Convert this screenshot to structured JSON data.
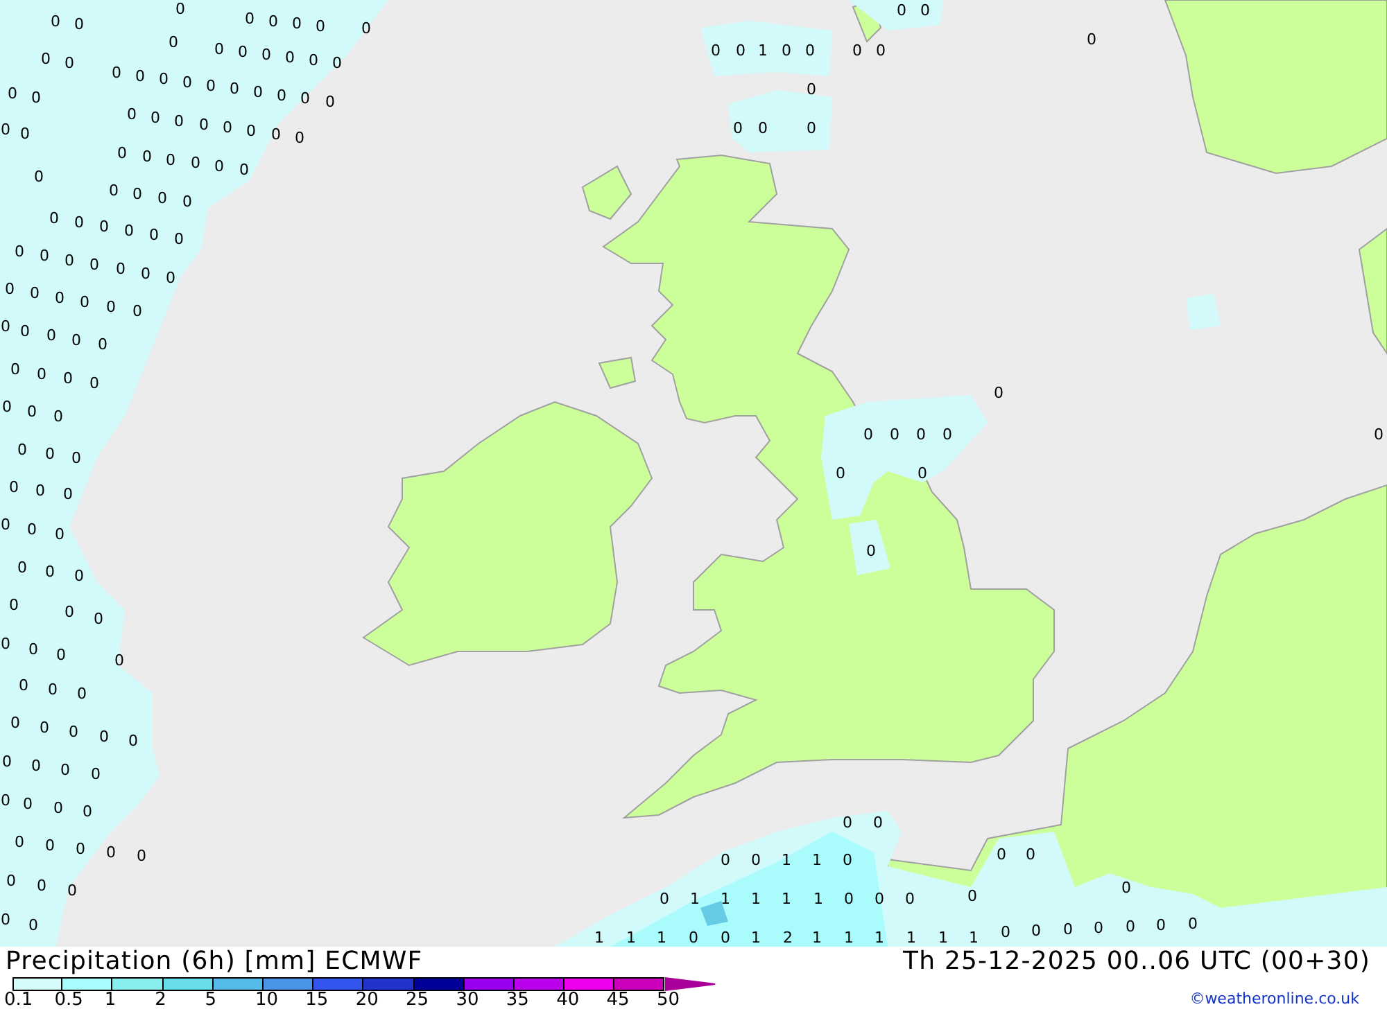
{
  "map": {
    "value_rows": [
      [
        "0"
      ],
      [
        "0",
        "0"
      ],
      [
        "0",
        "0"
      ],
      [
        "0",
        "0",
        "0",
        "0",
        "0"
      ],
      [
        "0"
      ],
      [
        "0"
      ],
      [
        "0",
        "0"
      ],
      [
        "0",
        "0",
        "0",
        "0",
        "0",
        "0"
      ],
      [
        "0",
        "0",
        "1",
        "0",
        "0"
      ],
      [
        "0",
        "0"
      ],
      [
        "0",
        "0"
      ],
      [
        "0",
        "0",
        "0",
        "0",
        "0",
        "0",
        "0",
        "0",
        "0",
        "0"
      ],
      [
        "0"
      ],
      [
        "0",
        "0"
      ],
      [
        "0",
        "0",
        "0",
        "0",
        "0",
        "0",
        "0",
        "0"
      ],
      [
        "0",
        "0",
        "0"
      ],
      [
        "0"
      ],
      [
        "0",
        "0",
        "0",
        "0",
        "0",
        "0"
      ],
      [
        "0",
        "0",
        "0",
        "0"
      ],
      [
        "0",
        "0",
        "0",
        "0",
        "0",
        "0"
      ],
      [
        "0",
        "0",
        "0",
        "0",
        "0",
        "0",
        "0"
      ],
      [
        "0",
        "0",
        "0",
        "0",
        "0",
        "0"
      ],
      [
        "0",
        "0",
        "0",
        "0",
        "0"
      ],
      [
        "0",
        "0",
        "0",
        "0"
      ],
      [
        "0"
      ],
      [
        "0",
        "0",
        "0"
      ],
      [
        "0",
        "0",
        "0",
        "0"
      ],
      [
        "0"
      ],
      [
        "0",
        "0",
        "0"
      ],
      [
        "0",
        "0"
      ],
      [
        "0",
        "0",
        "0"
      ],
      [
        "0",
        "0",
        "0"
      ],
      [
        "0"
      ],
      [
        "0",
        "0",
        "0"
      ],
      [
        "0",
        "0",
        "0"
      ],
      [
        "0",
        "0",
        "0"
      ],
      [
        "0"
      ],
      [
        "0",
        "0",
        "0"
      ],
      [
        "0",
        "0",
        "0",
        "0",
        "0"
      ],
      [
        "0",
        "0",
        "0",
        "0"
      ],
      [
        "0",
        "0",
        "0",
        "0"
      ],
      [
        "0",
        "0"
      ],
      [
        "0",
        "0",
        "0",
        "0",
        "0"
      ],
      [
        "0",
        "0"
      ],
      [
        "0",
        "0",
        "1",
        "1",
        "0"
      ],
      [
        "0",
        "0",
        "0"
      ],
      [
        "0",
        "1",
        "1",
        "1",
        "1",
        "1",
        "0",
        "0",
        "0"
      ],
      [
        "0"
      ],
      [
        "0"
      ],
      [
        "0",
        "0"
      ],
      [
        "1",
        "1",
        "1",
        "0",
        "0",
        "1",
        "2",
        "1",
        "1",
        "1",
        "1",
        "1",
        "1"
      ],
      [
        "0",
        "0",
        "0",
        "0",
        "0",
        "0",
        "0"
      ]
    ]
  },
  "legend": {
    "title": "Precipitation (6h) [mm] ECMWF",
    "valid_time": "Th 25-12-2025 00..06 UTC (00+30)",
    "scale": [
      {
        "label": "0.1",
        "color": "#d4fafa"
      },
      {
        "label": "0.5",
        "color": "#a8fcfc"
      },
      {
        "label": "1",
        "color": "#88eeee"
      },
      {
        "label": "2",
        "color": "#66dde8"
      },
      {
        "label": "5",
        "color": "#55bbe8"
      },
      {
        "label": "10",
        "color": "#4a94e8"
      },
      {
        "label": "15",
        "color": "#3355ee"
      },
      {
        "label": "20",
        "color": "#2233cc"
      },
      {
        "label": "25",
        "color": "#000099"
      },
      {
        "label": "30",
        "color": "#9900ee"
      },
      {
        "label": "35",
        "color": "#bb00ee"
      },
      {
        "label": "40",
        "color": "#ee00ee"
      },
      {
        "label": "45",
        "color": "#cc00bb"
      },
      {
        "label": "50",
        "color": "#aa0099"
      }
    ],
    "credit": "©weatheronline.co.uk"
  }
}
